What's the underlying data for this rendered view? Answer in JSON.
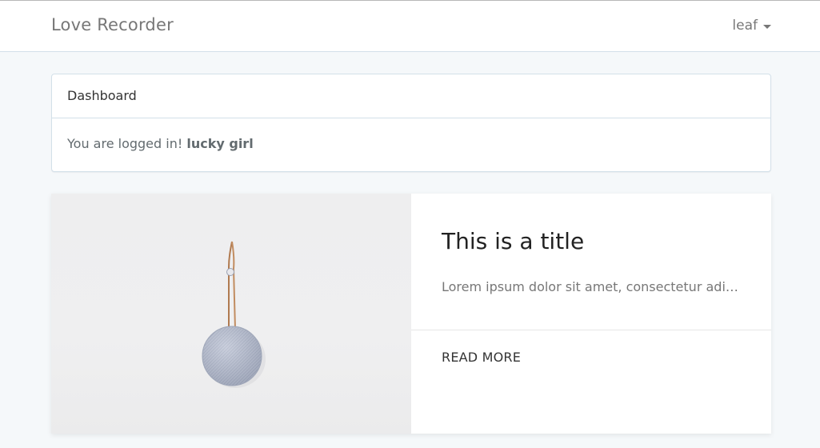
{
  "navbar": {
    "brand": "Love Recorder",
    "user": "leaf"
  },
  "panel": {
    "heading": "Dashboard",
    "body_prefix": "You are logged in!",
    "body_name": "lucky girl"
  },
  "card": {
    "title": "This is a title",
    "text": "Lorem ipsum dolor sit amet, consectetur adipiscing elit.",
    "action_label": "READ MORE"
  },
  "icons": {
    "user_menu": "chevron-down-icon",
    "card_image": "hanging-speaker-image"
  },
  "colors": {
    "page_background": "#f5f8fa",
    "navbar_background": "#ffffff",
    "panel_border": "#d3e0e9",
    "text": "#636b6f"
  }
}
